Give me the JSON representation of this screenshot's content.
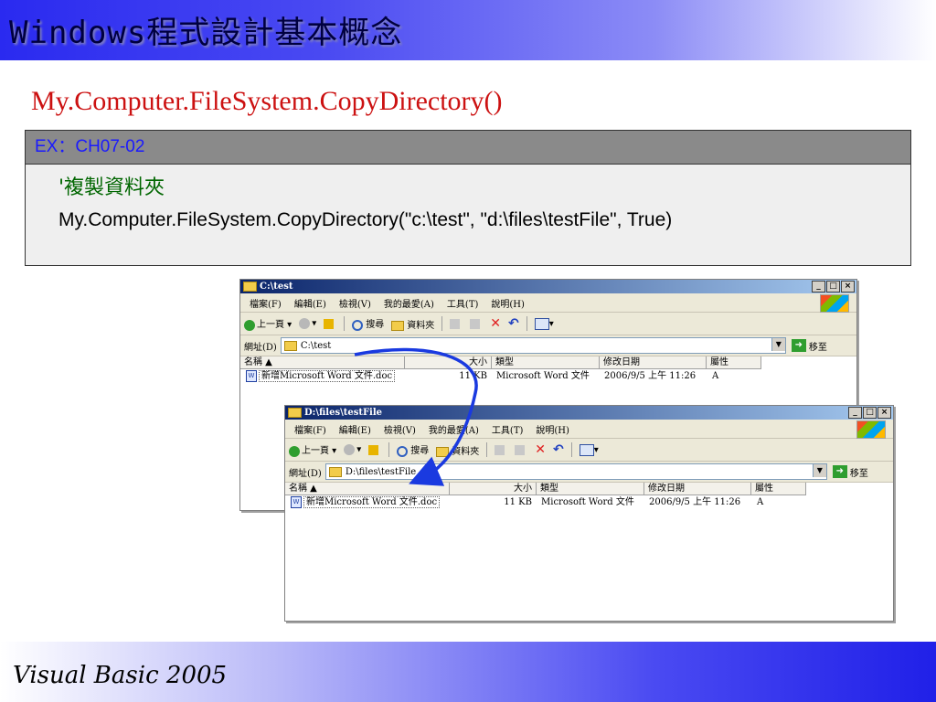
{
  "header": {
    "title": "Windows程式設計基本概念"
  },
  "subtitle": "My.Computer.FileSystem.CopyDirectory()",
  "example": {
    "label": "EX：CH07-02",
    "comment": "'複製資料夾",
    "code": "My.Computer.FileSystem.CopyDirectory(\"c:\\test\", \"d:\\files\\testFile\", True)"
  },
  "explorer_menu": [
    "檔案(F)",
    "編輯(E)",
    "檢視(V)",
    "我的最愛(A)",
    "工具(T)",
    "說明(H)"
  ],
  "explorer_toolbar": {
    "back": "上一頁",
    "search": "搜尋",
    "folders": "資料夾"
  },
  "address_label": "網址(D)",
  "go_label": "移至",
  "columns": {
    "name": "名稱",
    "size": "大小",
    "type": "類型",
    "modified": "修改日期",
    "attr": "屬性"
  },
  "window_source": {
    "title": "C:\\test",
    "address": "C:\\test",
    "file": {
      "name": "新增Microsoft Word 文件.doc",
      "size": "11 KB",
      "type": "Microsoft Word 文件",
      "modified": "2006/9/5 上午 11:26",
      "attr": "A"
    }
  },
  "window_dest": {
    "title": "D:\\files\\testFile",
    "address": "D:\\files\\testFile",
    "file": {
      "name": "新增Microsoft Word 文件.doc",
      "size": "11 KB",
      "type": "Microsoft Word 文件",
      "modified": "2006/9/5 上午 11:26",
      "attr": "A"
    }
  },
  "footer": {
    "text": "Visual Basic 2005"
  },
  "colors": {
    "header_blue": "#2a2af0",
    "subtitle_red": "#cc1111",
    "comment_green": "#006600",
    "arrow_blue": "#1a3ae0"
  }
}
